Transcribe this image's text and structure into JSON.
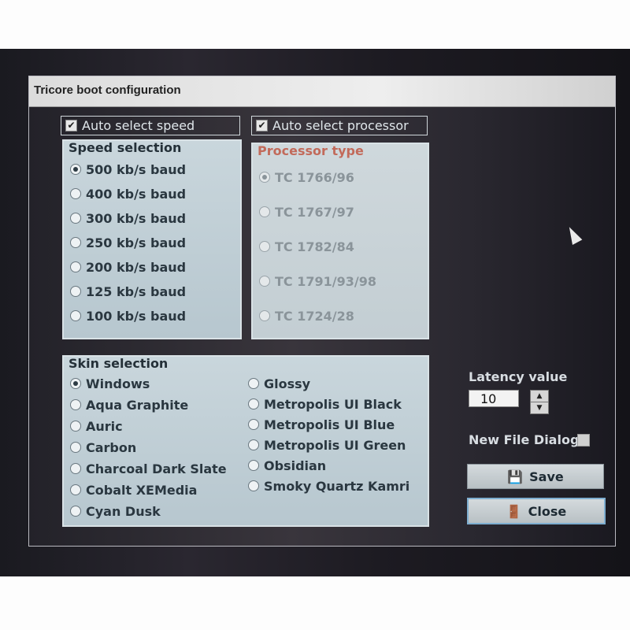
{
  "window": {
    "title": "Tricore boot configuration"
  },
  "auto_select_speed": {
    "label": "Auto select speed",
    "checked": true
  },
  "auto_select_processor": {
    "label": "Auto select processor",
    "checked": true
  },
  "speed_selection": {
    "title": "Speed selection",
    "options": [
      {
        "label": "500 kb/s baud",
        "selected": true
      },
      {
        "label": "400 kb/s baud",
        "selected": false
      },
      {
        "label": "300 kb/s baud",
        "selected": false
      },
      {
        "label": "250 kb/s baud",
        "selected": false
      },
      {
        "label": "200 kb/s baud",
        "selected": false
      },
      {
        "label": "125 kb/s baud",
        "selected": false
      },
      {
        "label": "100 kb/s baud",
        "selected": false
      }
    ]
  },
  "processor_type": {
    "title": "Processor type",
    "options": [
      {
        "label": "TC 1766/96",
        "selected": true
      },
      {
        "label": "TC 1767/97",
        "selected": false
      },
      {
        "label": "TC 1782/84",
        "selected": false
      },
      {
        "label": "TC 1791/93/98",
        "selected": false
      },
      {
        "label": "TC 1724/28",
        "selected": false
      }
    ]
  },
  "skin_selection": {
    "title": "Skin selection",
    "left": [
      {
        "label": "Windows",
        "selected": true
      },
      {
        "label": "Aqua Graphite",
        "selected": false
      },
      {
        "label": "Auric",
        "selected": false
      },
      {
        "label": "Carbon",
        "selected": false
      },
      {
        "label": "Charcoal Dark Slate",
        "selected": false
      },
      {
        "label": "Cobalt XEMedia",
        "selected": false
      },
      {
        "label": "Cyan Dusk",
        "selected": false
      }
    ],
    "right": [
      {
        "label": "Glossy",
        "selected": false
      },
      {
        "label": "Metropolis UI Black",
        "selected": false
      },
      {
        "label": "Metropolis UI Blue",
        "selected": false
      },
      {
        "label": "Metropolis UI Green",
        "selected": false
      },
      {
        "label": "Obsidian",
        "selected": false
      },
      {
        "label": "Smoky Quartz Kamri",
        "selected": false
      }
    ]
  },
  "latency": {
    "label": "Latency value",
    "value": "10"
  },
  "new_file_dialog": {
    "label": "New File Dialog",
    "checked": false
  },
  "buttons": {
    "save": "Save",
    "close": "Close"
  },
  "icons": {
    "save": "floppy-disk-icon",
    "close": "close-door-icon",
    "cursor": "mouse-cursor-icon"
  }
}
